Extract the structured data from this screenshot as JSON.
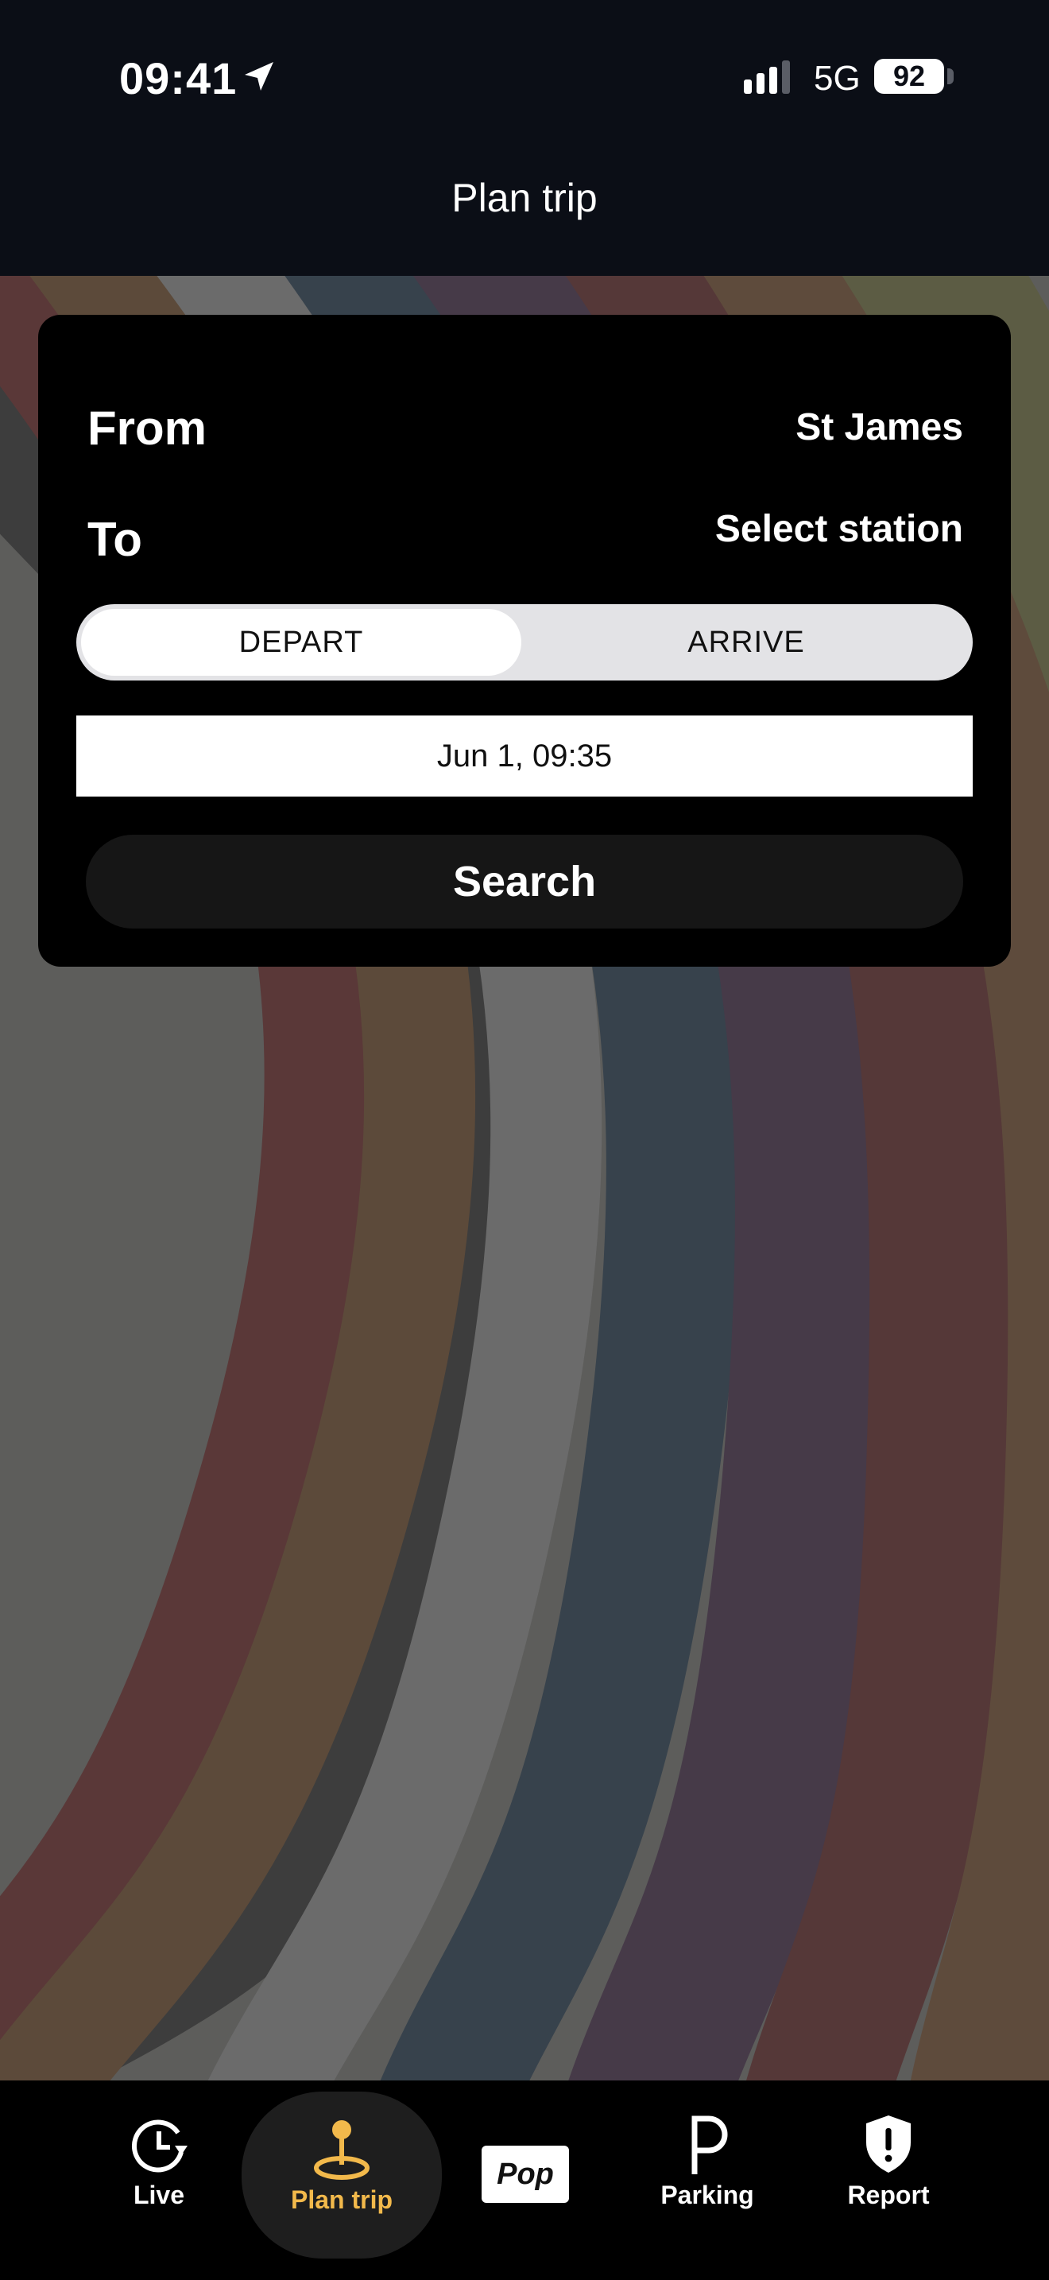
{
  "status": {
    "time": "09:41",
    "network": "5G",
    "battery": "92"
  },
  "header": {
    "title": "Plan trip"
  },
  "planner": {
    "from_label": "From",
    "from_value": "St James",
    "to_label": "To",
    "to_value": "Select station",
    "mode_options": [
      "DEPART",
      "ARRIVE"
    ],
    "mode_selected": "DEPART",
    "datetime": "Jun 1, 09:35",
    "search_label": "Search"
  },
  "tabs": [
    {
      "label": "Live",
      "icon": "clock-refresh-icon",
      "active": false
    },
    {
      "label": "Plan trip",
      "icon": "map-pin-icon",
      "active": true
    },
    {
      "label": "Pop",
      "icon": "pop-card-icon",
      "active": false
    },
    {
      "label": "Parking",
      "icon": "parking-icon",
      "active": false
    },
    {
      "label": "Report",
      "icon": "shield-alert-icon",
      "active": false
    }
  ],
  "colors": {
    "accent": "#f2b94b",
    "card": "#000000",
    "header": "#0b0e16"
  }
}
